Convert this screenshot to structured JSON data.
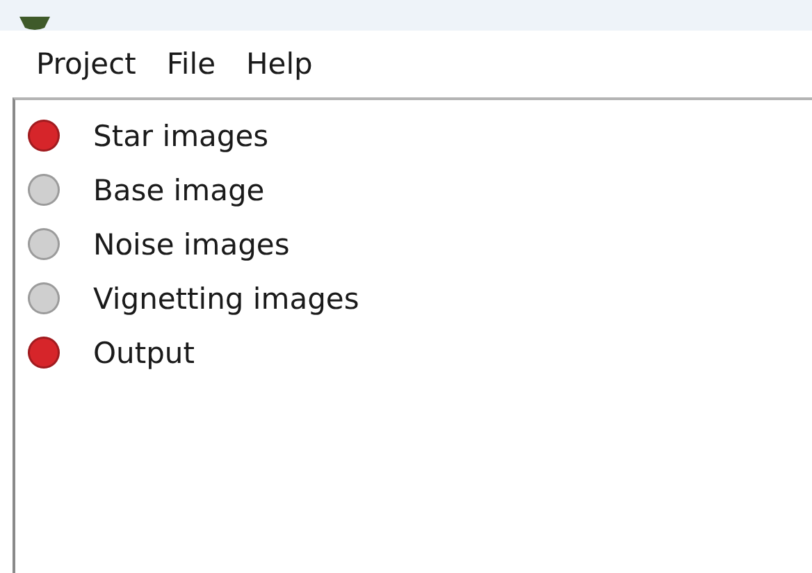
{
  "menu": [
    {
      "label": "Project"
    },
    {
      "label": "File"
    },
    {
      "label": "Help"
    }
  ],
  "steps": [
    {
      "label": "Star images",
      "color": "#d6252a"
    },
    {
      "label": "Base image",
      "color": "#cfcfcf"
    },
    {
      "label": "Noise images",
      "color": "#cfcfcf"
    },
    {
      "label": "Vignetting images",
      "color": "#cfcfcf"
    },
    {
      "label": "Output",
      "color": "#d6252a"
    }
  ]
}
